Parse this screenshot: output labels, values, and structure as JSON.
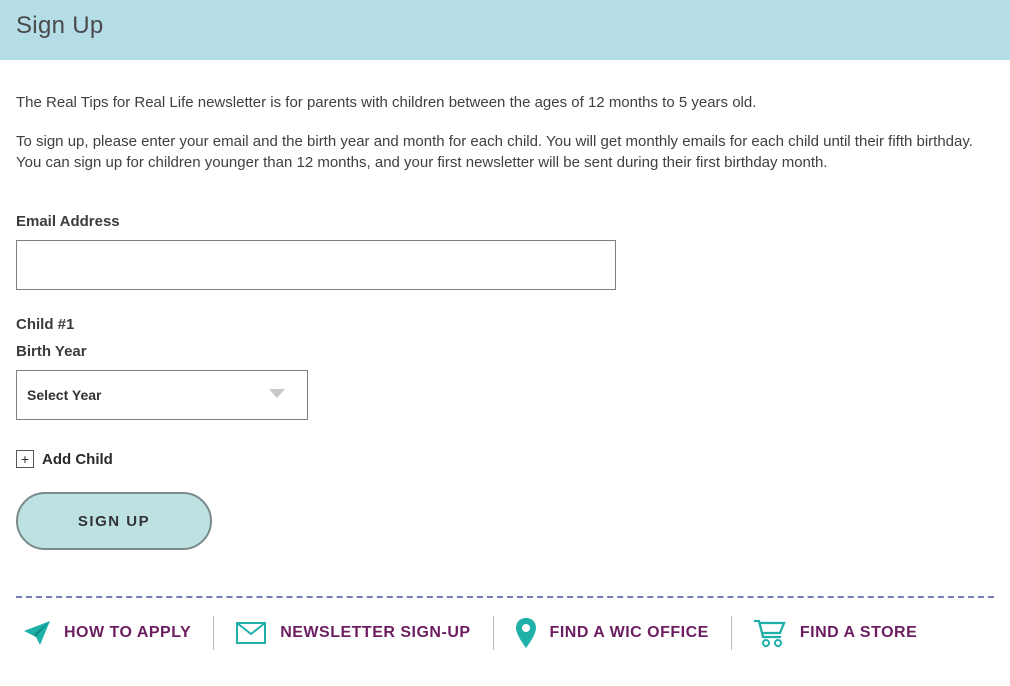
{
  "header": {
    "title": "Sign Up"
  },
  "intro": {
    "p1": "The Real Tips for Real Life newsletter is for parents with children between the ages of 12 months to 5 years old.",
    "p2": "To sign up, please enter your email and the birth year and month for each child. You will get monthly emails for each child until their fifth birthday. You can sign up for children younger than 12 months, and your first newsletter will be sent during their first birthday month."
  },
  "form": {
    "email_label": "Email Address",
    "email_value": "",
    "child_heading": "Child #1",
    "birth_year_label": "Birth Year",
    "birth_year_selected": "Select Year",
    "add_child_label": "Add Child",
    "submit_label": "SIGN UP"
  },
  "footer": {
    "items": [
      {
        "label": "HOW TO APPLY"
      },
      {
        "label": "NEWSLETTER SIGN-UP"
      },
      {
        "label": "FIND A WIC OFFICE"
      },
      {
        "label": "FIND A STORE"
      }
    ]
  },
  "colors": {
    "teal": "#1eb0a9",
    "purple": "#6c1d5f",
    "header_bg": "#b4dde8"
  }
}
